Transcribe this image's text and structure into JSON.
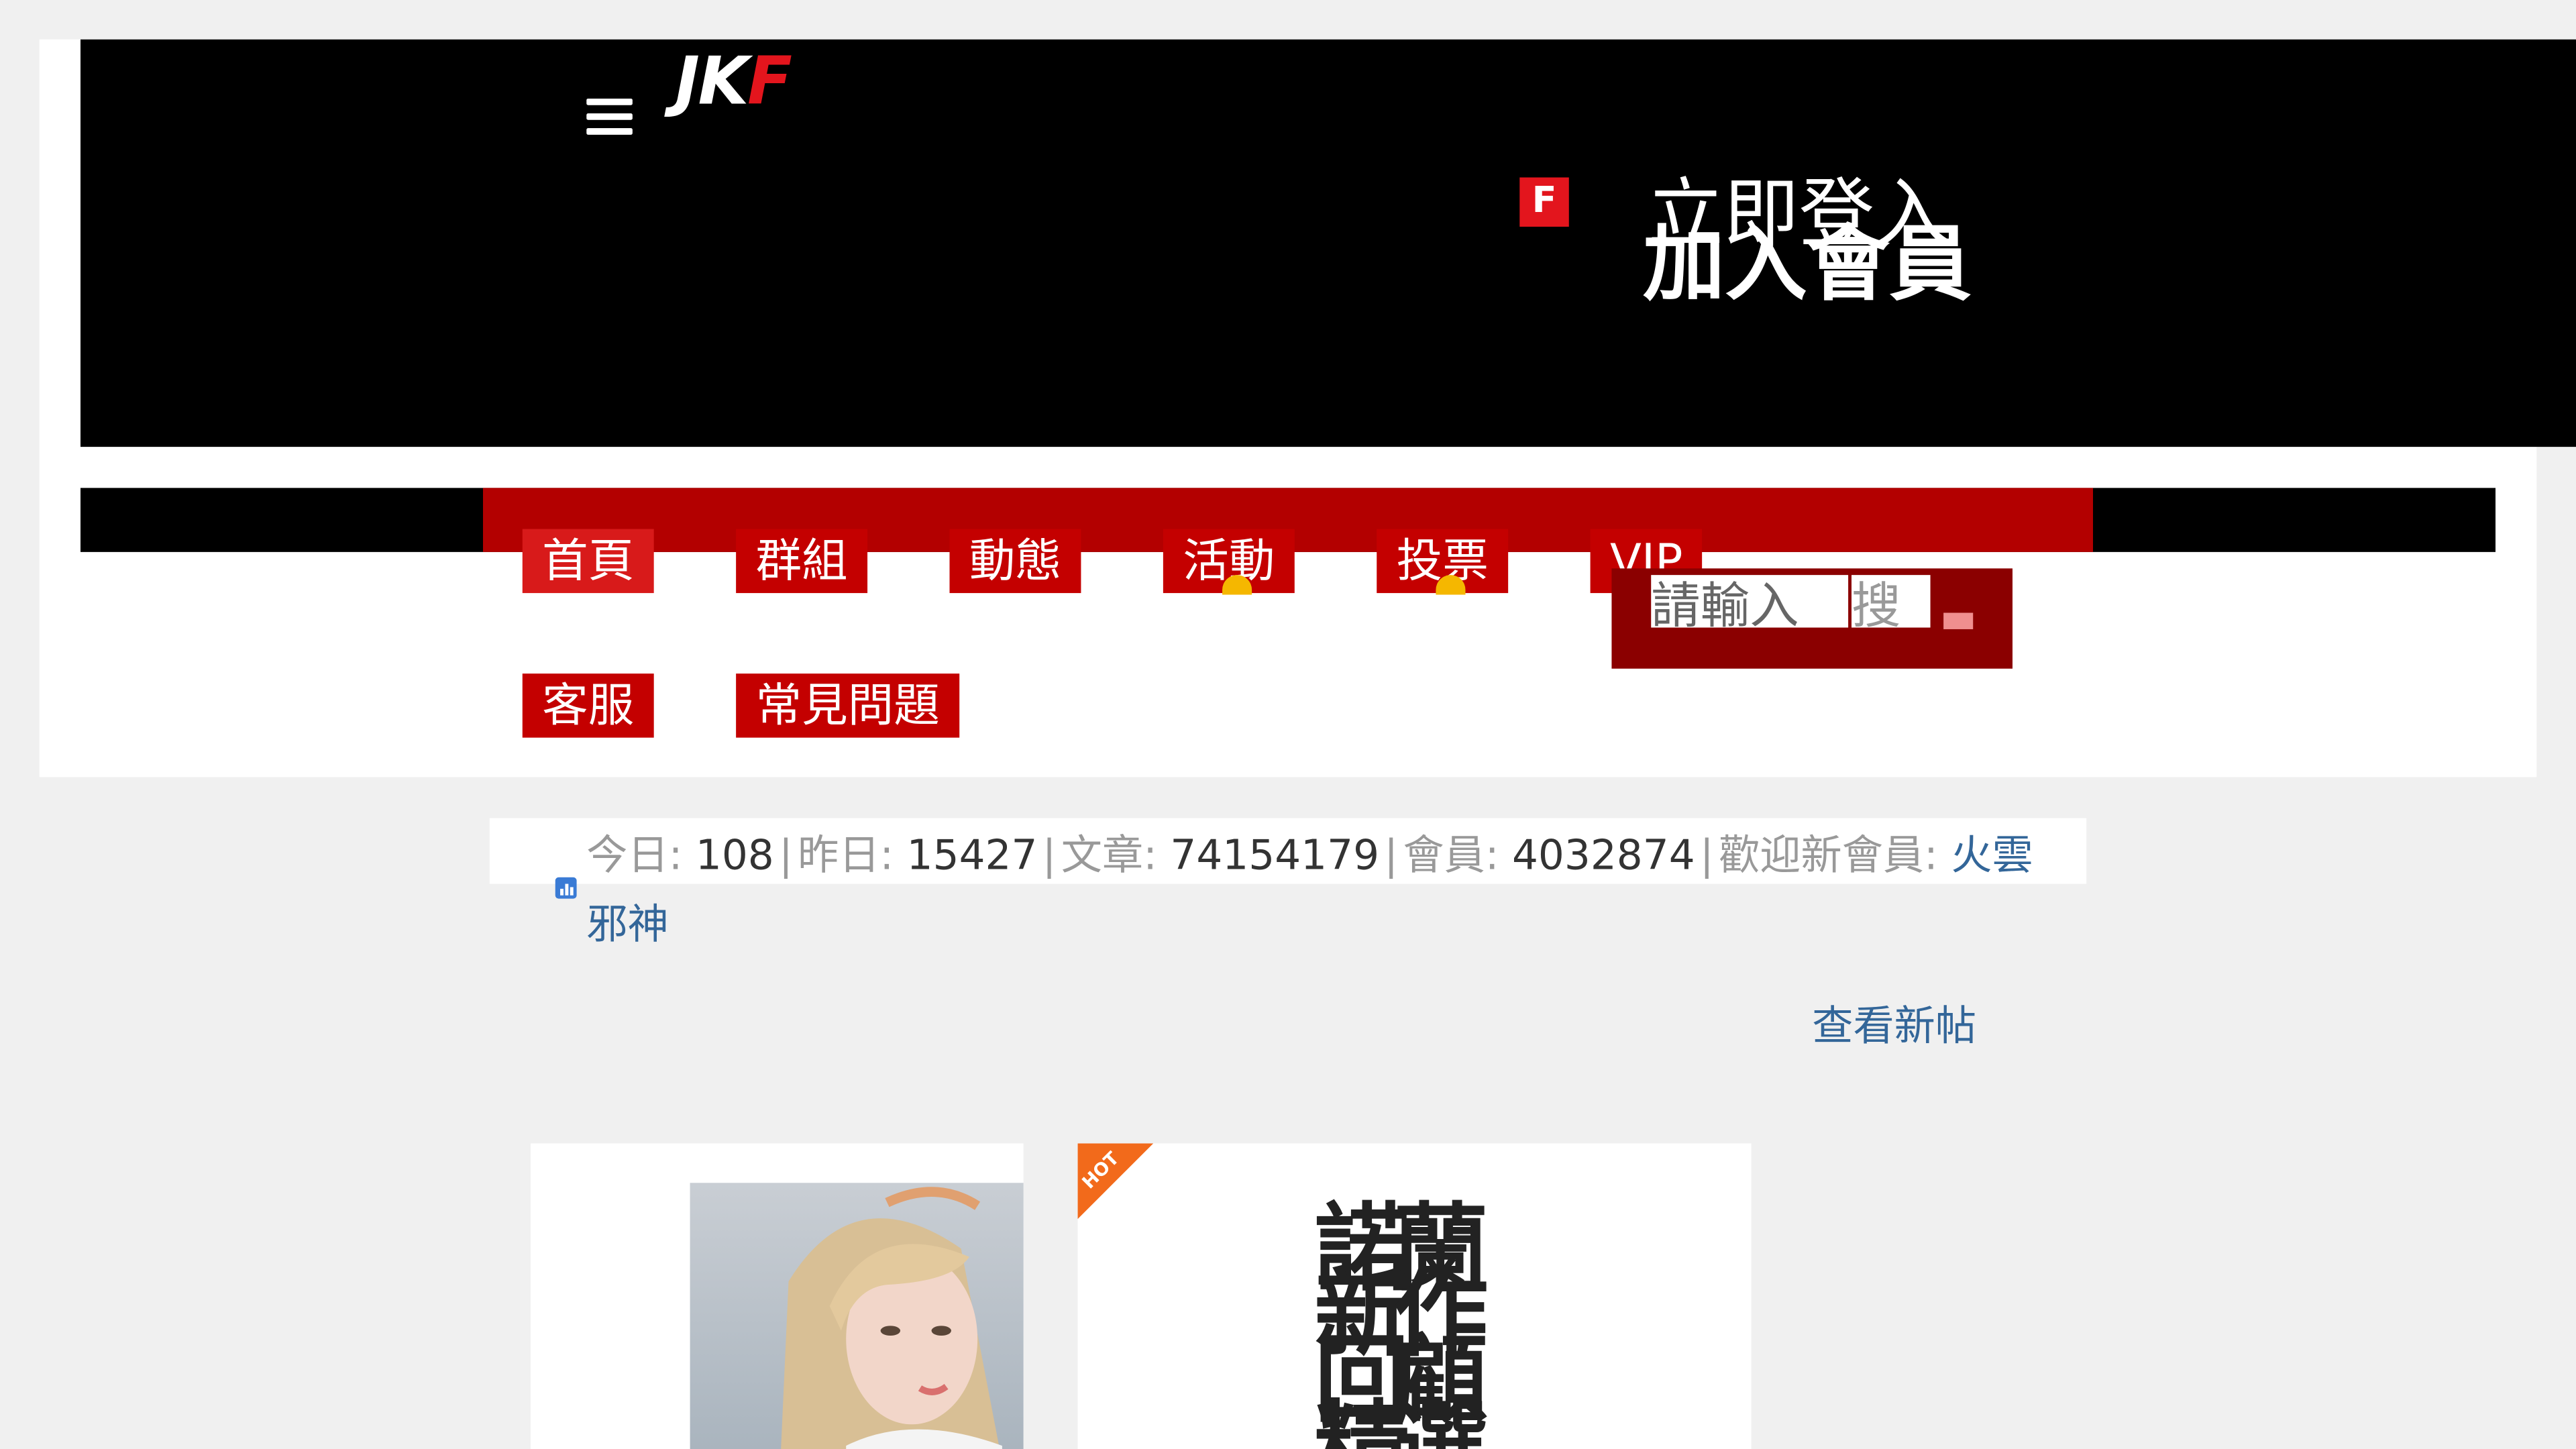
{
  "header": {
    "logo_main": "JK",
    "logo_accent": "F",
    "facebook_icon_label": "F",
    "login_label": "立即登入",
    "join_label": "加入會員"
  },
  "nav": {
    "items": [
      {
        "label": "首頁"
      },
      {
        "label": "群組"
      },
      {
        "label": "動態"
      },
      {
        "label": "活動"
      },
      {
        "label": "投票"
      },
      {
        "label": "VIP"
      },
      {
        "label": "客服"
      },
      {
        "label": "常見問題"
      }
    ],
    "search_placeholder": "請輸入",
    "search_button_label": "搜"
  },
  "stats": {
    "today_label": "今日:",
    "today_value": "108",
    "yesterday_label": "昨日:",
    "yesterday_value": "15427",
    "posts_label": "文章:",
    "posts_value": "74154179",
    "members_label": "會員:",
    "members_value": "4032874",
    "welcome_label": "歡迎新會員:",
    "new_member": "火雲邪神",
    "separator": "|",
    "view_new_posts": "查看新帖"
  },
  "cards": {
    "hot_label": "HOT",
    "card2_title": "諾蘭新作回顧精選"
  },
  "colors": {
    "header_bg": "#000000",
    "nav_red": "#b30000",
    "brand_red": "#e3151d",
    "link_blue": "#336699",
    "hot_orange": "#f26a1b"
  }
}
